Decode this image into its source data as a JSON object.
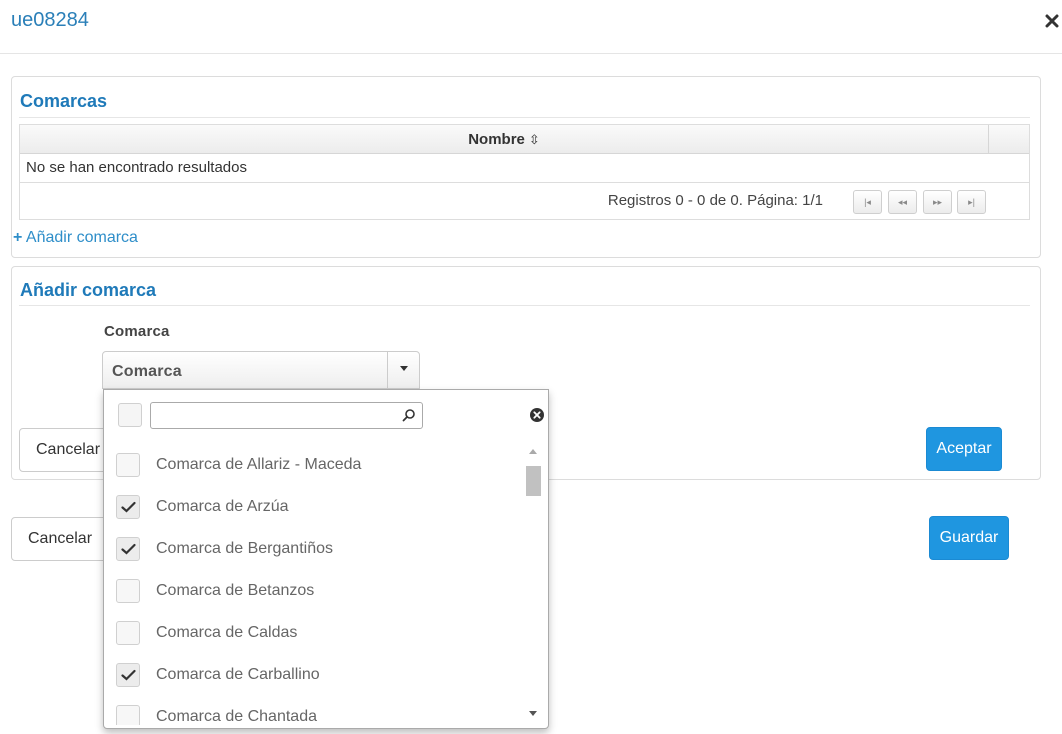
{
  "modal": {
    "title": "ue08284",
    "close_icon": "close-icon"
  },
  "comarcas_panel": {
    "title": "Comarcas",
    "table": {
      "columns": [
        {
          "label": "Nombre",
          "sort_icon": "⇳"
        }
      ],
      "empty_message": "No se han encontrado resultados",
      "records_text": "Registros 0 - 0 de 0. Página: 1/1",
      "pager": {
        "first": "|◂",
        "prev": "◂◂",
        "next": "▸▸",
        "last": "▸|"
      }
    },
    "add_link": {
      "plus": "+",
      "label": "Añadir comarca"
    }
  },
  "add_panel": {
    "title": "Añadir comarca",
    "field_label": "Comarca",
    "select_value": "Comarca",
    "cancel_label": "Cancelar",
    "accept_label": "Aceptar"
  },
  "footer": {
    "cancel_label": "Cancelar",
    "save_label": "Guardar"
  },
  "dropdown": {
    "search_value": "",
    "items": [
      {
        "label": "Comarca de Allariz - Maceda",
        "checked": false
      },
      {
        "label": "Comarca de Arzúa",
        "checked": true
      },
      {
        "label": "Comarca de Bergantiños",
        "checked": true
      },
      {
        "label": "Comarca de Betanzos",
        "checked": false
      },
      {
        "label": "Comarca de Caldas",
        "checked": false
      },
      {
        "label": "Comarca de Carballino",
        "checked": true
      },
      {
        "label": "Comarca de Chantada",
        "checked": false
      }
    ]
  },
  "colors": {
    "link": "#2e8ec9",
    "panel_title": "#1f7ab9",
    "primary_button": "#1f96e0"
  }
}
